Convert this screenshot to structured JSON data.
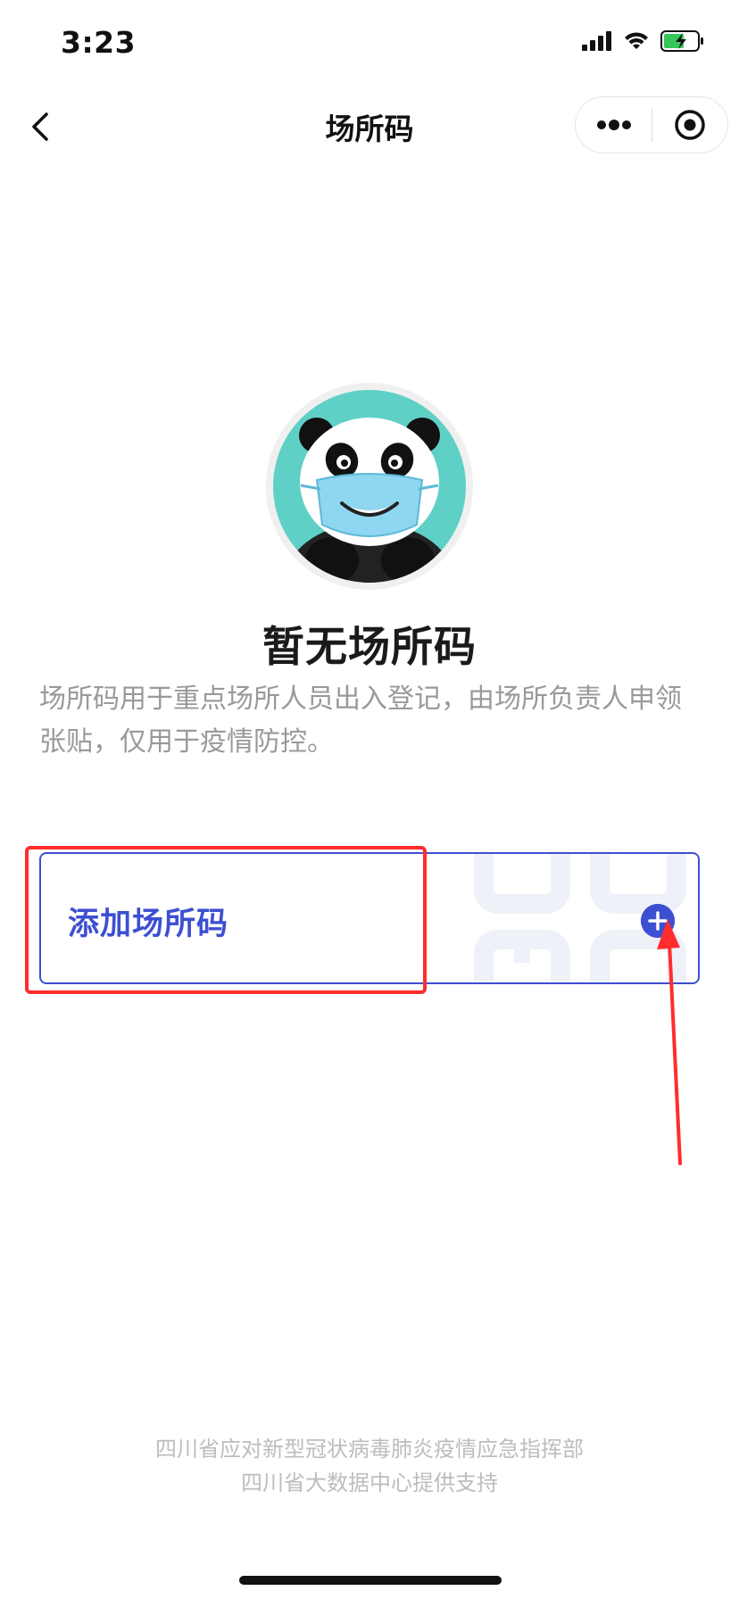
{
  "status_bar": {
    "time": "3:23",
    "icons": [
      "signal-icon",
      "wifi-icon",
      "battery-charging-icon"
    ]
  },
  "nav": {
    "title": "场所码",
    "back_icon": "chevron-left-icon",
    "more_icon": "more-dots-icon",
    "close_icon": "target-circle-icon"
  },
  "empty_state": {
    "illustration": "panda-with-mask",
    "title": "暂无场所码",
    "description": "场所码用于重点场所人员出入登记，由场所负责人申领张贴，仅用于疫情防控。"
  },
  "add_card": {
    "label": "添加场所码",
    "action_icon": "plus-circle-icon"
  },
  "footer": {
    "line1": "四川省应对新型冠状病毒肺炎疫情应急指挥部",
    "line2": "四川省大数据中心提供支持"
  },
  "colors": {
    "accent": "#3d4fd1",
    "annotation": "#ff2d2d",
    "panda_bg": "#5fd0c6",
    "muted_text": "#999999",
    "footer_text": "#bdbdbd"
  }
}
